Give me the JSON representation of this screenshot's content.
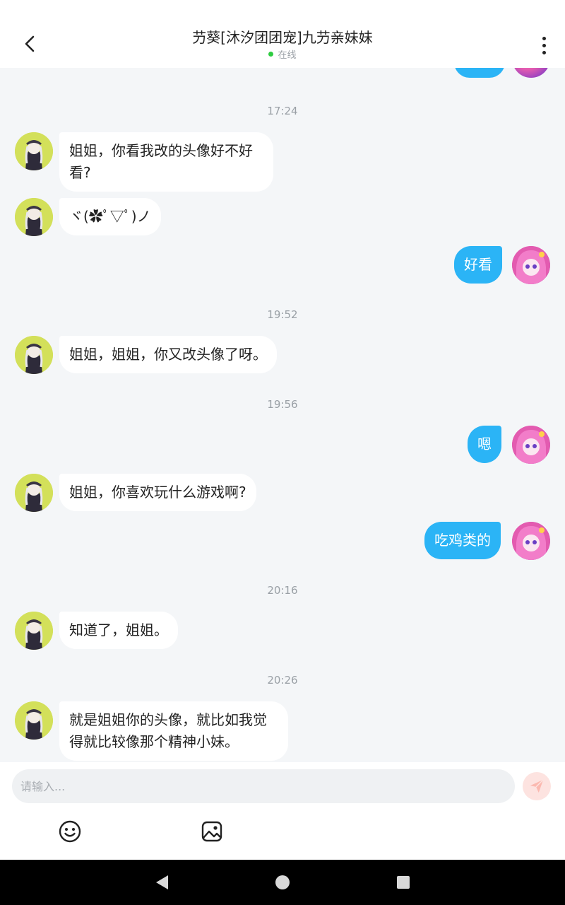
{
  "header": {
    "title": "芀葵[沐汐团团宠]九芀亲妹妹",
    "status": "在线"
  },
  "messages": [
    {
      "type": "time",
      "text": "17:24"
    },
    {
      "type": "them",
      "text": "姐姐，你看我改的头像好不好看?"
    },
    {
      "type": "them",
      "text": "ヾ(✿ﾟ▽ﾟ)ノ"
    },
    {
      "type": "me",
      "text": "好看"
    },
    {
      "type": "time",
      "text": "19:52"
    },
    {
      "type": "them",
      "text": "姐姐，姐姐，你又改头像了呀。"
    },
    {
      "type": "time",
      "text": "19:56"
    },
    {
      "type": "me",
      "text": "嗯"
    },
    {
      "type": "them",
      "text": "姐姐，你喜欢玩什么游戏啊?"
    },
    {
      "type": "me",
      "text": "吃鸡类的"
    },
    {
      "type": "time",
      "text": "20:16"
    },
    {
      "type": "them",
      "text": "知道了，姐姐。"
    },
    {
      "type": "time",
      "text": "20:26"
    },
    {
      "type": "them",
      "text": "就是姐姐你的头像，就比如我觉得就比较像那个精神小妹。"
    }
  ],
  "input": {
    "placeholder": "请输入...",
    "value": ""
  },
  "icons": {
    "back": "back-arrow-icon",
    "more": "more-vertical-icon",
    "send": "send-icon",
    "emoji": "emoji-icon",
    "image": "image-icon",
    "nav_back": "nav-back-icon",
    "nav_home": "nav-home-icon",
    "nav_recents": "nav-recents-icon"
  },
  "colors": {
    "outgoing_bubble": "#2bb4f6",
    "incoming_bubble": "#ffffff",
    "background": "#f4f6f8",
    "online_dot": "#2ecc40",
    "send_button": "#fde3e0"
  }
}
